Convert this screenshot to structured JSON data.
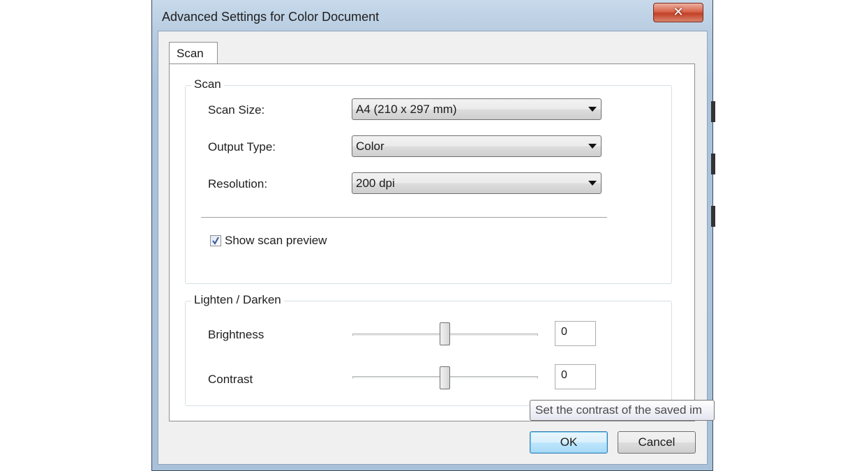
{
  "window": {
    "title": "Advanced Settings for Color Document",
    "close_label": "✕"
  },
  "tabs": [
    {
      "label": "Scan",
      "selected": true
    }
  ],
  "scan_group": {
    "title": "Scan",
    "scan_size": {
      "label": "Scan Size:",
      "value": "A4 (210 x 297 mm)"
    },
    "output_type": {
      "label": "Output Type:",
      "value": "Color"
    },
    "resolution": {
      "label": "Resolution:",
      "value": "200 dpi"
    },
    "show_preview": {
      "label": "Show scan preview",
      "checked": true
    }
  },
  "lighten_group": {
    "title": "Lighten / Darken",
    "brightness": {
      "label": "Brightness",
      "value": "0",
      "slider_level": 0.5
    },
    "contrast": {
      "label": "Contrast",
      "value": "0",
      "slider_level": 0.5
    }
  },
  "tooltip": {
    "text": "Set the contrast of the saved im"
  },
  "buttons": {
    "ok": "OK",
    "cancel": "Cancel"
  },
  "icons": {
    "close": "close-icon",
    "dropdown": "chevron-down-icon",
    "check": "checkmark-icon"
  }
}
